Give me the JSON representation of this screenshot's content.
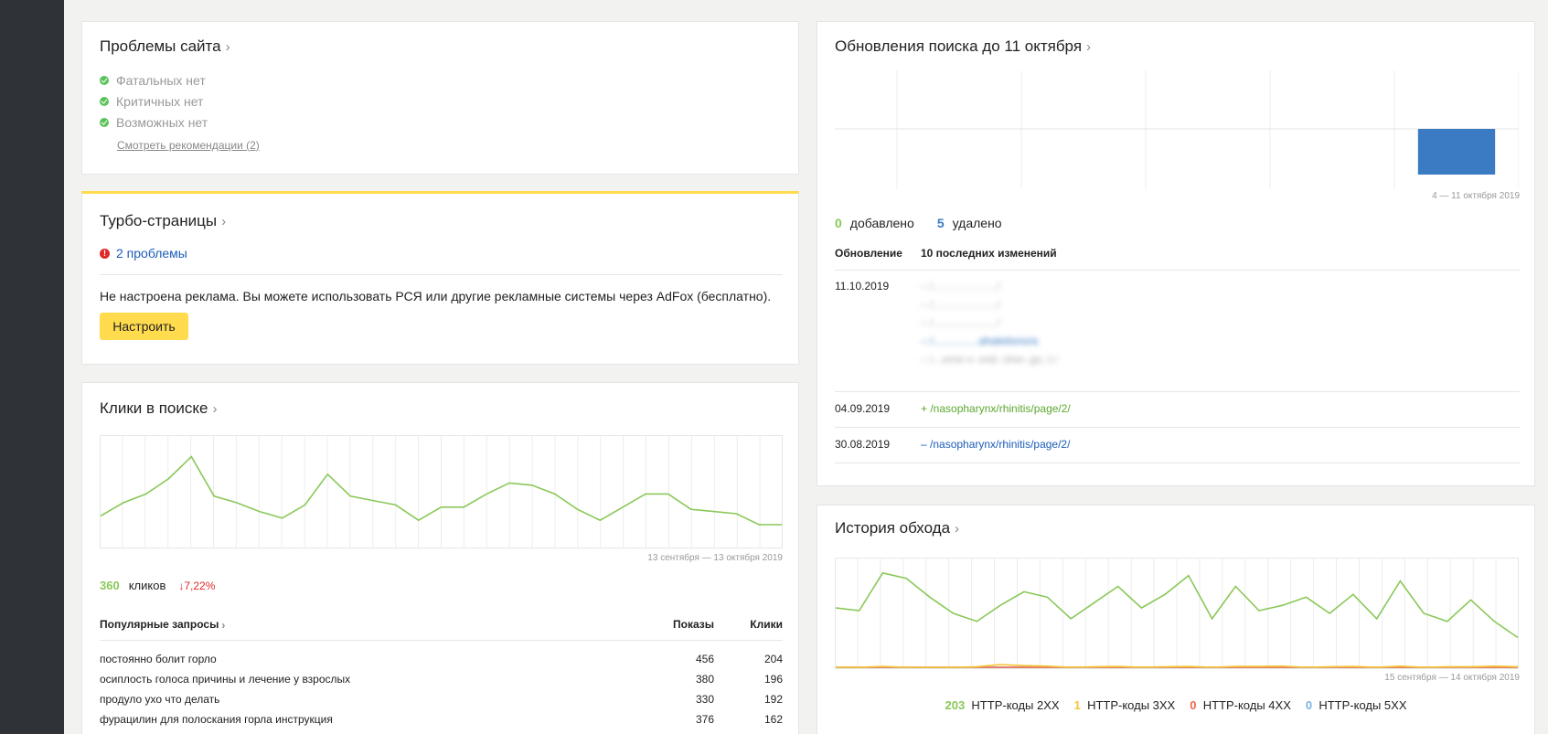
{
  "site_problems": {
    "title": "Проблемы сайта",
    "items": [
      "Фатальных нет",
      "Критичных нет",
      "Возможных нет"
    ],
    "recommendations_link": "Смотреть рекомендации (2)"
  },
  "turbo": {
    "title": "Турбо-страницы",
    "problems_link": "2 проблемы",
    "ad_notice": "Не настроена реклама. Вы можете использовать РСЯ или другие рекламные системы через AdFox (бесплатно).",
    "configure_button": "Настроить"
  },
  "clicks": {
    "title": "Клики в поиске",
    "period": "13 сентября — 13 октября 2019",
    "total": "360",
    "total_label": "кликов",
    "change": "↓7,22%",
    "table_headers": {
      "query": "Популярные запросы",
      "shows": "Показы",
      "clicks": "Клики"
    },
    "rows": [
      {
        "query": "постоянно болит горло",
        "shows": "456",
        "clicks": "204"
      },
      {
        "query": "осиплость голоса причины и лечение у взрослых",
        "shows": "380",
        "clicks": "196"
      },
      {
        "query": "продуло ухо что делать",
        "shows": "330",
        "clicks": "192"
      },
      {
        "query": "фурацилин для полоскания горла инструкция",
        "shows": "376",
        "clicks": "162"
      }
    ]
  },
  "search_updates": {
    "title": "Обновления поиска до 11 октября",
    "period": "4 — 11 октября 2019",
    "added_count": "0",
    "added_label": "добавлено",
    "removed_count": "5",
    "removed_label": "удалено",
    "table_headers": {
      "update": "Обновление",
      "changes": "10 последних изменений"
    },
    "entries": [
      {
        "date": "11.10.2019",
        "changes": [
          "– /...................../",
          "– /...................../",
          "– /...................../",
          "– /...............ahaletions/a",
          "– /...eme-v-.esti-.shei-.go..t./"
        ]
      },
      {
        "date": "04.09.2019",
        "changes": [
          "+ /nasopharynx/rhinitis/page/2/"
        ]
      },
      {
        "date": "30.08.2019",
        "changes": [
          "– /nasopharynx/rhinitis/page/2/"
        ]
      }
    ]
  },
  "crawl_history": {
    "title": "История обхода",
    "period": "15 сентября — 14 октября 2019",
    "legend": [
      {
        "count": "203",
        "label": "HTTP-коды 2XX",
        "color": "#8ac858"
      },
      {
        "count": "1",
        "label": "HTTP-коды 3XX",
        "color": "#f5c531"
      },
      {
        "count": "0",
        "label": "HTTP-коды 4XX",
        "color": "#f0664a"
      },
      {
        "count": "0",
        "label": "HTTP-коды 5XX",
        "color": "#7ab3e0"
      }
    ]
  },
  "colors": {
    "green": "#8ac858",
    "blue": "#3a7bc4",
    "red": "#e02828",
    "yellow": "#ffdb4d",
    "link_blue": "#1d5db8"
  },
  "chart_data": [
    {
      "type": "line",
      "title": "Клики в поиске",
      "series": [
        {
          "values": [
            14,
            20,
            24,
            31,
            41,
            23,
            20,
            16,
            13,
            19,
            33,
            23,
            21,
            19,
            12,
            18,
            18,
            24,
            29,
            28,
            24,
            17,
            12,
            18,
            24,
            24,
            17,
            16,
            15,
            10,
            10
          ]
        }
      ],
      "ylim": [
        0,
        50
      ],
      "grid": true
    },
    {
      "type": "bar",
      "title": "Обновления поиска до 11 октября",
      "categories": [
        "",
        "",
        "",
        "",
        "4 — 11 октября 2019"
      ],
      "values": [
        0,
        0,
        0,
        0,
        5
      ],
      "ylim": [
        0,
        10
      ],
      "grid": true
    },
    {
      "type": "line",
      "title": "История обхода",
      "series": [
        {
          "name": "HTTP-коды 2XX",
          "values": [
            22,
            21,
            35,
            33,
            26,
            20,
            17,
            23,
            28,
            26,
            18,
            24,
            30,
            22,
            27,
            34,
            18,
            30,
            21,
            23,
            26,
            20,
            27,
            18,
            32,
            20,
            17,
            25,
            17,
            11
          ]
        },
        {
          "name": "HTTP-коды 3XX",
          "values": [
            0,
            0,
            0.3,
            0,
            0,
            0,
            0.2,
            1,
            0.6,
            0.4,
            0,
            0.2,
            0.3,
            0,
            0.2,
            0.3,
            0,
            0.3,
            0.3,
            0.4,
            0,
            0.2,
            0.3,
            0,
            0.4,
            0,
            0.2,
            0.2,
            0.4,
            0.2
          ]
        },
        {
          "name": "HTTP-коды 4XX",
          "values": [
            0,
            0,
            0,
            0,
            0,
            0,
            0,
            0,
            0,
            0,
            0,
            0,
            0,
            0,
            0,
            0,
            0,
            0,
            0,
            0,
            0,
            0,
            0,
            0,
            0,
            0,
            0,
            0,
            0,
            0
          ]
        },
        {
          "name": "HTTP-коды 5XX",
          "values": [
            0,
            0,
            0,
            0,
            0,
            0,
            0,
            0,
            0,
            0,
            0,
            0,
            0,
            0,
            0,
            0,
            0,
            0,
            0,
            0,
            0,
            0,
            0,
            0,
            0,
            0,
            0,
            0,
            0,
            0
          ]
        }
      ],
      "ylim": [
        0,
        40
      ],
      "grid": true
    }
  ]
}
